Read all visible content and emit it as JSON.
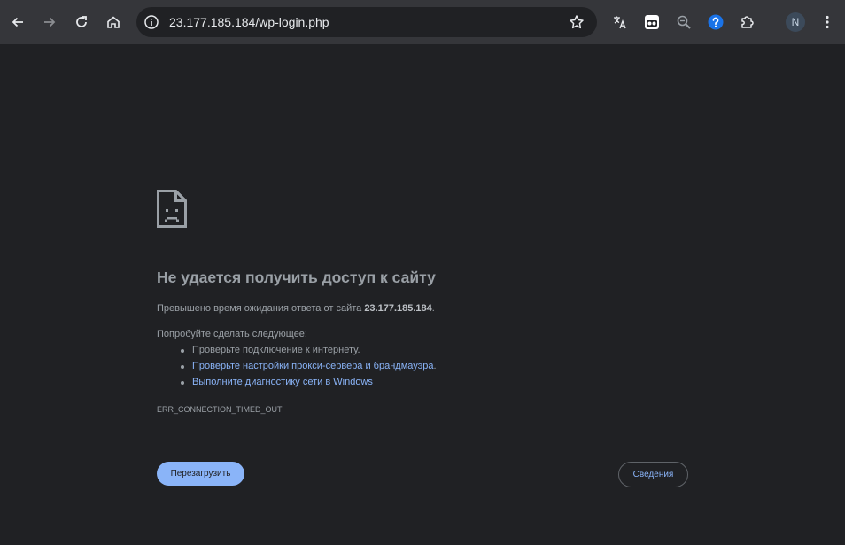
{
  "omnibox": {
    "url": "23.177.185.184/wp-login.php"
  },
  "toolbar": {
    "profile_initial": "N"
  },
  "error": {
    "title": "Не удается получить доступ к сайту",
    "desc_prefix": "Превышено время ожидания ответа от сайта ",
    "desc_host": "23.177.185.184",
    "desc_suffix": ".",
    "try_label": "Попробуйте сделать следующее:",
    "suggestions": [
      "Проверьте подключение к интернету.",
      "Проверьте настройки прокси-сервера и брандмауэра",
      "Выполните диагностику сети в Windows"
    ],
    "suggestion_2_suffix": ".",
    "code": "ERR_CONNECTION_TIMED_OUT"
  },
  "buttons": {
    "reload": "Перезагрузить",
    "details": "Сведения"
  },
  "colors": {
    "toolbar_bg": "#35363a",
    "page_bg": "#202124",
    "accent": "#8ab4f8",
    "text": "#9aa0a6",
    "help_icon": "#1a73e8"
  },
  "icons": [
    "back-arrow-icon",
    "forward-arrow-icon",
    "reload-icon",
    "home-icon",
    "info-icon",
    "star-icon",
    "translate-icon",
    "reader-extension-icon",
    "zoom-icon",
    "help-icon",
    "extensions-puzzle-icon",
    "more-vert-icon",
    "sad-page-icon"
  ]
}
